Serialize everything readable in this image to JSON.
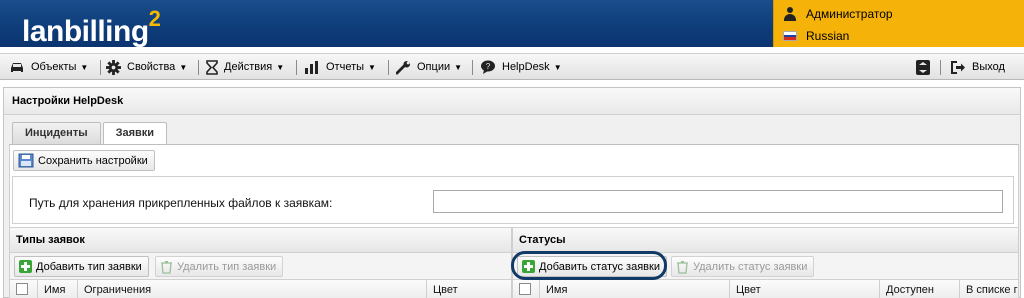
{
  "app": {
    "logo_text": "lanbilling",
    "logo_sup": "2",
    "user_name": "Администратор",
    "language": "Russian"
  },
  "menu": {
    "items": [
      {
        "label": "Объекты",
        "icon": "car-icon"
      },
      {
        "label": "Свойства",
        "icon": "gear-icon"
      },
      {
        "label": "Действия",
        "icon": "hourglass-icon"
      },
      {
        "label": "Отчеты",
        "icon": "bar-chart-icon"
      },
      {
        "label": "Опции",
        "icon": "wrench-icon"
      },
      {
        "label": "HelpDesk",
        "icon": "speech-bubble-icon"
      }
    ],
    "logout_label": "Выход"
  },
  "panel": {
    "title": "Настройки HelpDesk",
    "tabs": [
      {
        "label": "Инциденты",
        "active": false
      },
      {
        "label": "Заявки",
        "active": true
      }
    ],
    "save_button": "Сохранить настройки",
    "path_label": "Путь для хранения прикрепленных файлов к заявкам:",
    "path_value": ""
  },
  "types_panel": {
    "title": "Типы заявок",
    "add_button": "Добавить тип заявки",
    "delete_button": "Удалить тип заявки",
    "columns": [
      "Имя",
      "Ограничения",
      "Цвет"
    ]
  },
  "statuses_panel": {
    "title": "Статусы",
    "add_button": "Добавить статус заявки",
    "delete_button": "Удалить статус заявки",
    "columns": [
      "Имя",
      "Цвет",
      "Доступен",
      "В списке г"
    ]
  },
  "colors": {
    "header_blue": "#0f3f7c",
    "user_box": "#f5b30a",
    "highlight_ring": "#123a66",
    "add_green": "#3aa537"
  }
}
